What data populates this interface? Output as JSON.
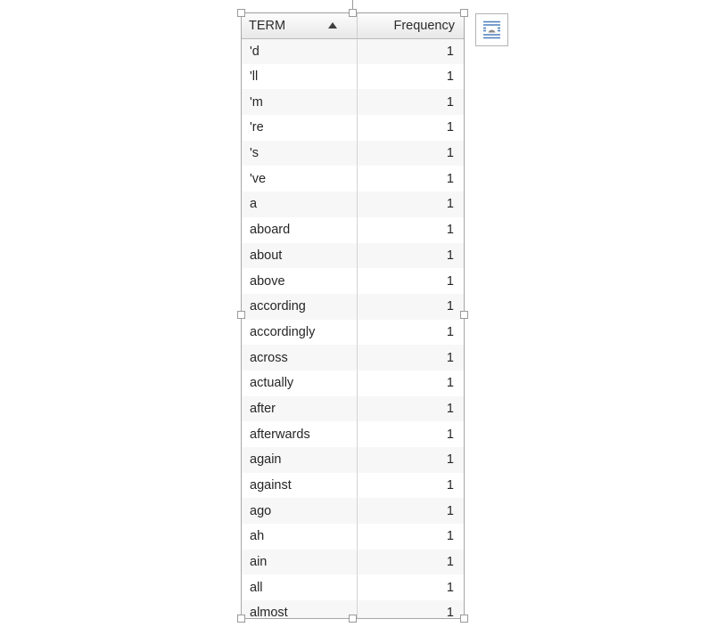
{
  "object": {
    "name": "term-frequency-table",
    "selected": true,
    "handles": [
      "top-left",
      "top-center",
      "top-right",
      "middle-left",
      "middle-right",
      "bottom-left",
      "bottom-center",
      "bottom-right"
    ],
    "rotate_handle": "rotation-handle"
  },
  "table": {
    "columns": [
      {
        "key": "term",
        "label": "TERM",
        "align": "left",
        "sorted": true,
        "sort_direction": "ascending",
        "sort_icon": "triangle-up-icon"
      },
      {
        "key": "frequency",
        "label": "Frequency",
        "align": "right",
        "sorted": false
      }
    ],
    "rows": [
      {
        "term": "'d",
        "frequency": "1"
      },
      {
        "term": "'ll",
        "frequency": "1"
      },
      {
        "term": "'m",
        "frequency": "1"
      },
      {
        "term": "'re",
        "frequency": "1"
      },
      {
        "term": "'s",
        "frequency": "1"
      },
      {
        "term": "'ve",
        "frequency": "1"
      },
      {
        "term": "a",
        "frequency": "1"
      },
      {
        "term": "aboard",
        "frequency": "1"
      },
      {
        "term": "about",
        "frequency": "1"
      },
      {
        "term": "above",
        "frequency": "1"
      },
      {
        "term": "according",
        "frequency": "1"
      },
      {
        "term": "accordingly",
        "frequency": "1"
      },
      {
        "term": "across",
        "frequency": "1"
      },
      {
        "term": "actually",
        "frequency": "1"
      },
      {
        "term": "after",
        "frequency": "1"
      },
      {
        "term": "afterwards",
        "frequency": "1"
      },
      {
        "term": "again",
        "frequency": "1"
      },
      {
        "term": "against",
        "frequency": "1"
      },
      {
        "term": "ago",
        "frequency": "1"
      },
      {
        "term": "ah",
        "frequency": "1"
      },
      {
        "term": "ain",
        "frequency": "1"
      },
      {
        "term": "all",
        "frequency": "1"
      },
      {
        "term": "almost",
        "frequency": "1"
      }
    ]
  },
  "layout_options": {
    "icon": "layout-options-icon",
    "line_color": "#4a7ebb",
    "object_color": "#808080"
  },
  "colors": {
    "border": "#a6a6a6",
    "header_text": "#2b2b2b",
    "cell_text": "#262626",
    "row_stripe": "#f7f7f7",
    "row_base": "#ffffff",
    "handle_fill": "#ffffff",
    "handle_border": "#9a9a9a"
  }
}
